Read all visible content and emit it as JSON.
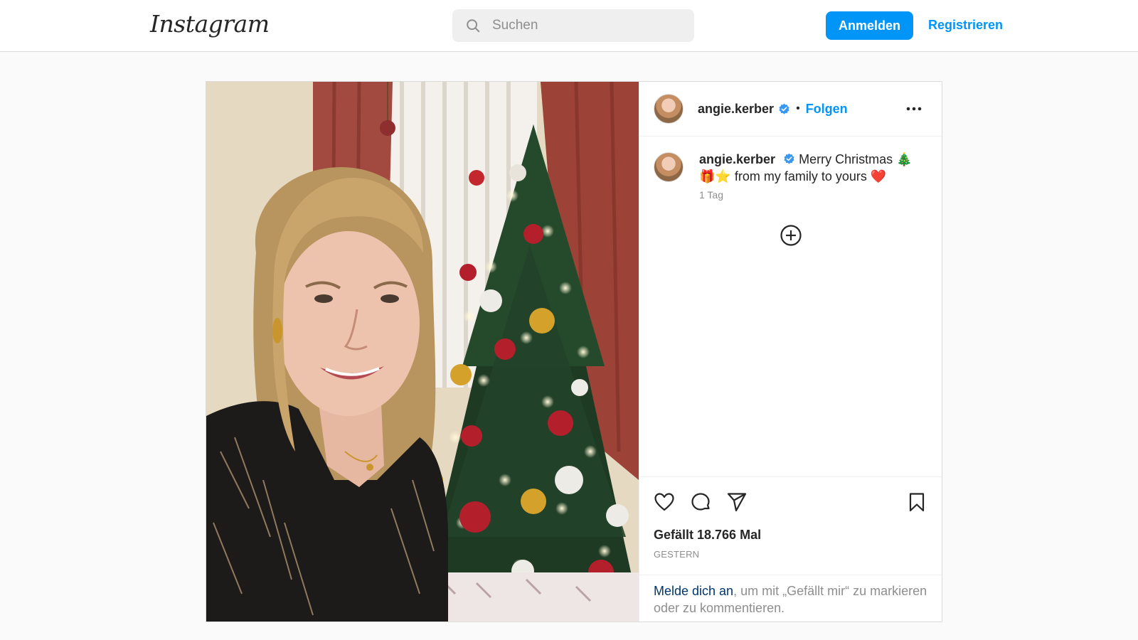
{
  "header": {
    "logo": "Instagram",
    "search_placeholder": "Suchen",
    "login_label": "Anmelden",
    "signup_label": "Registrieren"
  },
  "post": {
    "image_icon": "christmas-selfie-photo",
    "author": {
      "username": "angie.kerber",
      "verified_icon": "verified-badge-icon",
      "follow_label": "Folgen",
      "separator": "•"
    },
    "caption": {
      "username": "angie.kerber",
      "text": "Merry Christmas 🎄🎁⭐ from my family to yours ❤️",
      "time": "1 Tag"
    },
    "load_more_icon": "plus-circle-icon",
    "actions": {
      "like_icon": "heart-icon",
      "comment_icon": "comment-icon",
      "share_icon": "paper-plane-icon",
      "save_icon": "bookmark-icon"
    },
    "likes": "Gefällt 18.766 Mal",
    "date": "GESTERN",
    "login_prompt": {
      "link": "Melde dich an",
      "rest": ", um mit „Gefällt mir“ zu markieren oder zu kommentieren."
    }
  },
  "colors": {
    "accent": "#0095f6",
    "link_dark": "#00376b",
    "muted": "#8e8e8e",
    "border": "#dbdbdb"
  }
}
